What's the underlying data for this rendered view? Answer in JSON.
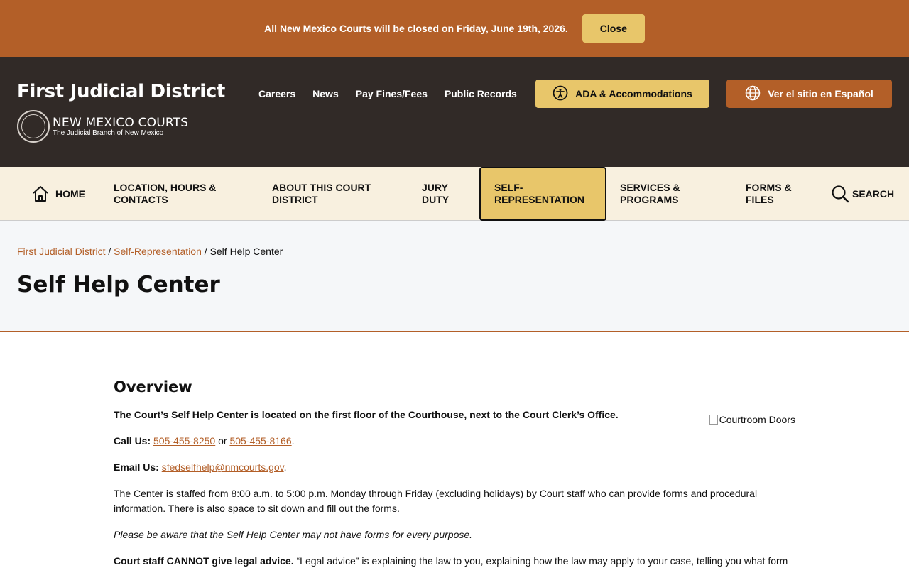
{
  "alert": {
    "text": "All New Mexico Courts will be closed on Friday, June 19th, 2026.",
    "close_label": "Close"
  },
  "header": {
    "site_title": "First Judicial District",
    "brand_name": "NEW MEXICO COURTS",
    "brand_sub": "The Judicial Branch of New Mexico",
    "util_links": [
      "Careers",
      "News",
      "Pay Fines/Fees",
      "Public Records"
    ],
    "ada_label": "ADA & Accommodations",
    "spanish_label": "Ver el sitio en Español"
  },
  "nav": {
    "home": "HOME",
    "location": "LOCATION, HOURS & CONTACTS",
    "about": "ABOUT THIS COURT DISTRICT",
    "jury": "JURY DUTY",
    "selfrep": "SELF-REPRESENTATION",
    "services": "SERVICES & PROGRAMS",
    "forms": "FORMS & FILES",
    "search": "SEARCH"
  },
  "breadcrumb": {
    "crumb1": "First Judicial District",
    "crumb2": "Self-Representation",
    "current": "Self Help Center",
    "sep": "/"
  },
  "page_title": "Self Help Center",
  "content": {
    "heading": "Overview",
    "image_alt": "Courtroom Doors",
    "location_text": "The Court’s Self Help Center is located on the first floor of the Courthouse, next to the Court Clerk’s Office.",
    "call_label": "Call Us:",
    "phone1": "505-455-8250",
    "or": "or",
    "phone2": "505-455-8166",
    "email_label": "Email Us:",
    "email": "sfedselfhelp@nmcourts.gov",
    "staffed_text": "The Center is staffed from 8:00 a.m. to 5:00 p.m. Monday through Friday (excluding holidays) by Court staff who can provide forms and procedural information. There is also space to sit down and fill out the forms.",
    "forms_note": "Please be aware that the Self Help Center may not have forms for every purpose.",
    "advice_bold": "Court staff CANNOT give legal advice.",
    "advice_text": "“Legal advice” is explaining the law to you, explaining how the law may apply to your case, telling you what form"
  },
  "colors": {
    "brand_orange": "#b35f28",
    "gold": "#e8c66a",
    "header_dark": "#312a27",
    "nav_cream": "#f8f0df"
  }
}
